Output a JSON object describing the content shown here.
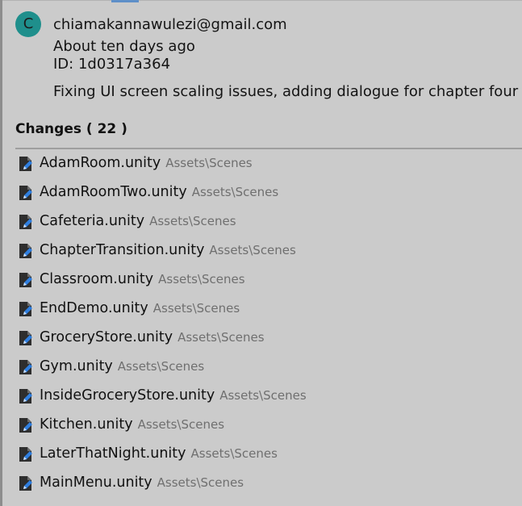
{
  "commit": {
    "avatar_initial": "C",
    "author_email": "chiamakannawulezi@gmail.com",
    "time_ago": "About ten days ago",
    "id_text": "ID: 1d0317a364",
    "message": "Fixing UI screen scaling issues, adding dialogue for chapter four"
  },
  "changes": {
    "header": "Changes ( 22 )",
    "files": [
      {
        "name": "AdamRoom.unity",
        "path": "Assets\\Scenes",
        "icon": "modified-file-icon"
      },
      {
        "name": "AdamRoomTwo.unity",
        "path": "Assets\\Scenes",
        "icon": "modified-file-icon"
      },
      {
        "name": "Cafeteria.unity",
        "path": "Assets\\Scenes",
        "icon": "modified-file-icon"
      },
      {
        "name": "ChapterTransition.unity",
        "path": "Assets\\Scenes",
        "icon": "modified-file-icon"
      },
      {
        "name": "Classroom.unity",
        "path": "Assets\\Scenes",
        "icon": "modified-file-icon"
      },
      {
        "name": "EndDemo.unity",
        "path": "Assets\\Scenes",
        "icon": "modified-file-icon"
      },
      {
        "name": "GroceryStore.unity",
        "path": "Assets\\Scenes",
        "icon": "modified-file-icon"
      },
      {
        "name": "Gym.unity",
        "path": "Assets\\Scenes",
        "icon": "modified-file-icon"
      },
      {
        "name": "InsideGroceryStore.unity",
        "path": "Assets\\Scenes",
        "icon": "modified-file-icon"
      },
      {
        "name": "Kitchen.unity",
        "path": "Assets\\Scenes",
        "icon": "modified-file-icon"
      },
      {
        "name": "LaterThatNight.unity",
        "path": "Assets\\Scenes",
        "icon": "modified-file-icon"
      },
      {
        "name": "MainMenu.unity",
        "path": "Assets\\Scenes",
        "icon": "modified-file-icon"
      }
    ]
  },
  "colors": {
    "background": "#cbcbcb",
    "avatar": "#1f8f8c",
    "icon_body": "#2e2e2e",
    "icon_pencil": "#2f7fe0",
    "path_text": "#6f6f6f"
  }
}
